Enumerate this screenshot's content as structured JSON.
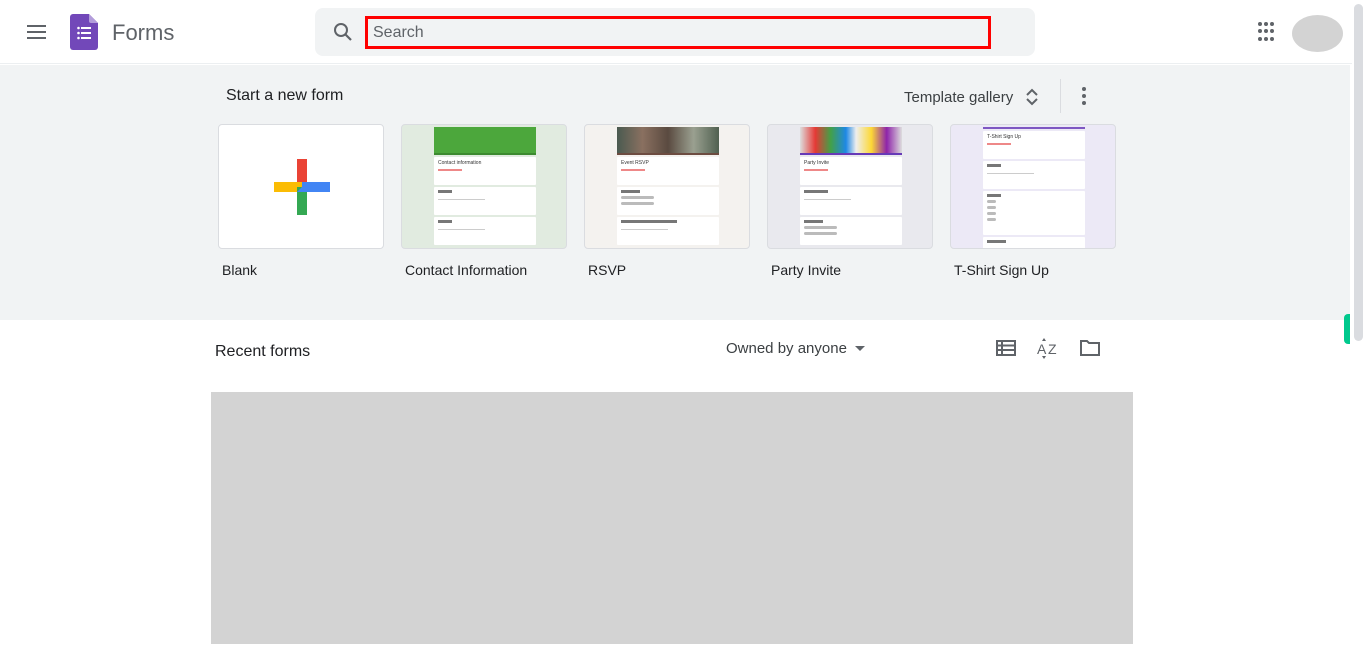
{
  "header": {
    "menu_icon": "hamburger-menu-icon",
    "logo_icon": "google-forms-logo-icon",
    "app_title": "Forms",
    "search": {
      "icon": "search-icon",
      "placeholder": "Search",
      "value": ""
    },
    "apps_icon": "apps-grid-icon",
    "avatar": "account-avatar"
  },
  "templates": {
    "section_title": "Start a new form",
    "gallery_label": "Template gallery",
    "gallery_icon": "unfold-more-icon",
    "more_icon": "more-vert-icon",
    "items": [
      {
        "label": "Blank",
        "thumb": "blank-plus"
      },
      {
        "label": "Contact Information",
        "thumb": "contact-information",
        "thumb_title": "Contact information",
        "accent": "#4ca73c",
        "bg": "#e1ebe0"
      },
      {
        "label": "RSVP",
        "thumb": "event-rsvp",
        "thumb_title": "Event RSVP",
        "accent": "#6d4c41",
        "bg": "#f4f2ef"
      },
      {
        "label": "Party Invite",
        "thumb": "party-invite",
        "thumb_title": "Party Invite",
        "accent": "#673ab7",
        "bg": "#e9e9ee"
      },
      {
        "label": "T-Shirt Sign Up",
        "thumb": "t-shirt-sign-up",
        "thumb_title": "T-Shirt Sign Up",
        "accent": "#7e57c2",
        "bg": "#ece9f6"
      }
    ]
  },
  "recent": {
    "title": "Recent forms",
    "owner_filter": "Owned by anyone",
    "list_view_icon": "list-view-icon",
    "sort_icon": "sort-az-icon",
    "folder_icon": "folder-icon"
  }
}
